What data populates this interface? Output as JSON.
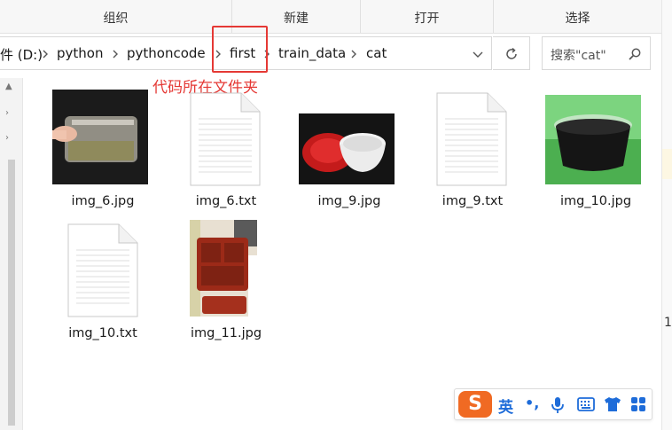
{
  "ribbon": {
    "groups": [
      "组织",
      "新建",
      "打开",
      "选择"
    ]
  },
  "address": {
    "crumbs": [
      "件 (D:)",
      "python",
      "pythoncode",
      "first",
      "train_data",
      "cat"
    ]
  },
  "search": {
    "placeholder": "搜索\"cat\""
  },
  "annotation": {
    "note": "代码所在文件夹",
    "color": "#e53935"
  },
  "files": [
    {
      "name": "img_6.jpg",
      "kind": "image"
    },
    {
      "name": "img_6.txt",
      "kind": "text"
    },
    {
      "name": "img_9.jpg",
      "kind": "image"
    },
    {
      "name": "img_9.txt",
      "kind": "text"
    },
    {
      "name": "img_10.jpg",
      "kind": "image"
    },
    {
      "name": "img_10.txt",
      "kind": "text"
    },
    {
      "name": "img_11.jpg",
      "kind": "image"
    }
  ],
  "right_edge": {
    "partial_text": "1"
  },
  "ime": {
    "logo": "S",
    "language": "英",
    "punctuation": "•,",
    "brand_color": "#f06a23",
    "icon_color": "#1e6cd9",
    "icons": [
      "microphone-icon",
      "keyboard-icon",
      "skin-icon",
      "toolbox-icon"
    ]
  }
}
